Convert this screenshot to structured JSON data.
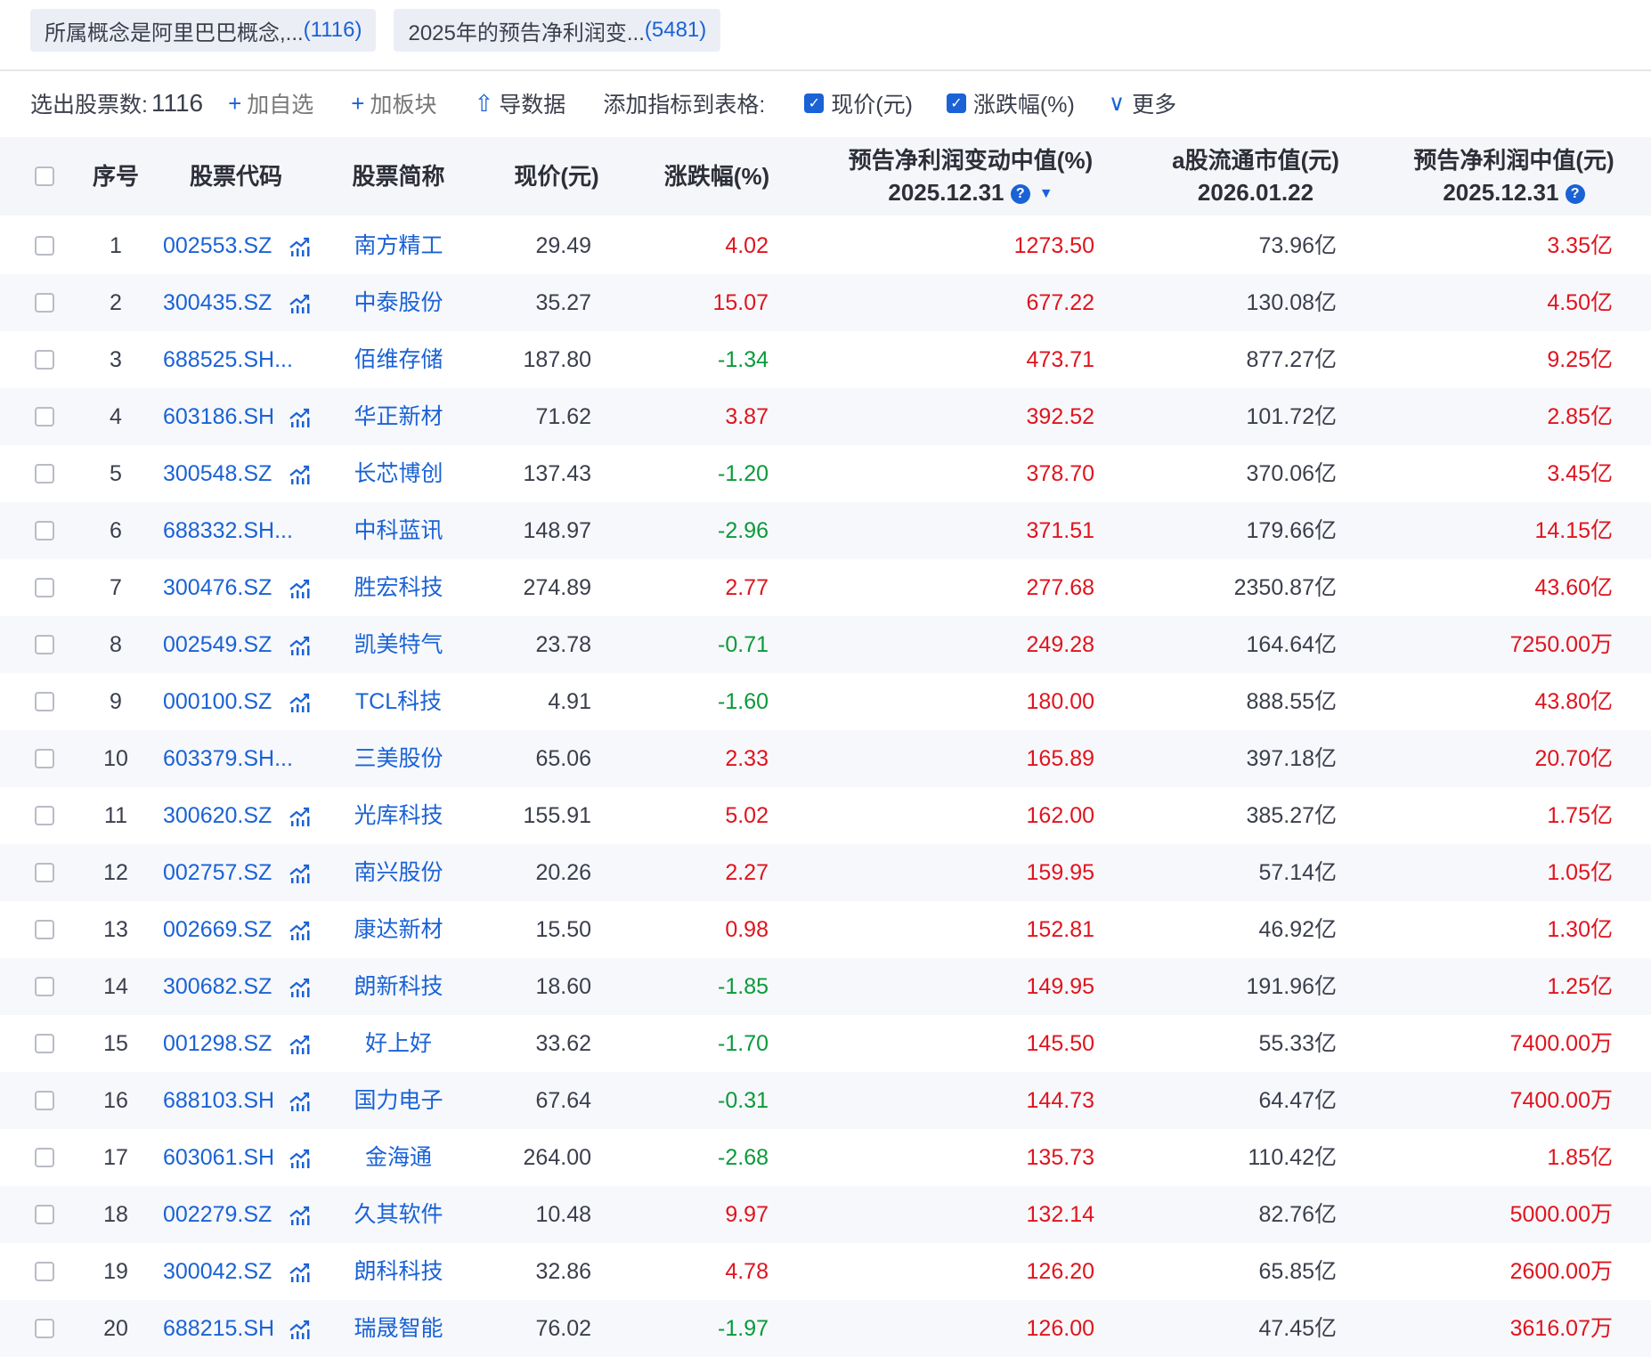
{
  "tabs": [
    {
      "label": "所属概念是阿里巴巴概念,...",
      "count": "(1116)"
    },
    {
      "label": "2025年的预告净利润变...",
      "count": "(5481)"
    }
  ],
  "toolbar": {
    "count_label": "选出股票数:",
    "count": "1116",
    "add_watch": "加自选",
    "add_sector": "加板块",
    "export": "导数据",
    "add_indicator": "添加指标到表格:",
    "cb_price": "现价(元)",
    "cb_change": "涨跌幅(%)",
    "more": "更多"
  },
  "columns": {
    "idx": "序号",
    "code": "股票代码",
    "name": "股票简称",
    "price": "现价(元)",
    "change": "涨跌幅(%)",
    "forecast_chg": "预告净利润变动中值(%)",
    "forecast_chg_date": "2025.12.31",
    "cap": "a股流通市值(元)",
    "cap_date": "2026.01.22",
    "forecast_val": "预告净利润中值(元)",
    "forecast_val_date": "2025.12.31"
  },
  "rows": [
    {
      "idx": "1",
      "code": "002553.SZ",
      "name": "南方精工",
      "price": "29.49",
      "change": "4.02",
      "fc": "1273.50",
      "cap": "73.96亿",
      "val": "3.35亿"
    },
    {
      "idx": "2",
      "code": "300435.SZ",
      "name": "中泰股份",
      "price": "35.27",
      "change": "15.07",
      "fc": "677.22",
      "cap": "130.08亿",
      "val": "4.50亿"
    },
    {
      "idx": "3",
      "code": "688525.SH...",
      "name": "佰维存储",
      "price": "187.80",
      "change": "-1.34",
      "fc": "473.71",
      "cap": "877.27亿",
      "val": "9.25亿"
    },
    {
      "idx": "4",
      "code": "603186.SH",
      "name": "华正新材",
      "price": "71.62",
      "change": "3.87",
      "fc": "392.52",
      "cap": "101.72亿",
      "val": "2.85亿"
    },
    {
      "idx": "5",
      "code": "300548.SZ",
      "name": "长芯博创",
      "price": "137.43",
      "change": "-1.20",
      "fc": "378.70",
      "cap": "370.06亿",
      "val": "3.45亿"
    },
    {
      "idx": "6",
      "code": "688332.SH...",
      "name": "中科蓝讯",
      "price": "148.97",
      "change": "-2.96",
      "fc": "371.51",
      "cap": "179.66亿",
      "val": "14.15亿"
    },
    {
      "idx": "7",
      "code": "300476.SZ",
      "name": "胜宏科技",
      "price": "274.89",
      "change": "2.77",
      "fc": "277.68",
      "cap": "2350.87亿",
      "val": "43.60亿"
    },
    {
      "idx": "8",
      "code": "002549.SZ",
      "name": "凯美特气",
      "price": "23.78",
      "change": "-0.71",
      "fc": "249.28",
      "cap": "164.64亿",
      "val": "7250.00万"
    },
    {
      "idx": "9",
      "code": "000100.SZ",
      "name": "TCL科技",
      "price": "4.91",
      "change": "-1.60",
      "fc": "180.00",
      "cap": "888.55亿",
      "val": "43.80亿"
    },
    {
      "idx": "10",
      "code": "603379.SH...",
      "name": "三美股份",
      "price": "65.06",
      "change": "2.33",
      "fc": "165.89",
      "cap": "397.18亿",
      "val": "20.70亿"
    },
    {
      "idx": "11",
      "code": "300620.SZ",
      "name": "光库科技",
      "price": "155.91",
      "change": "5.02",
      "fc": "162.00",
      "cap": "385.27亿",
      "val": "1.75亿"
    },
    {
      "idx": "12",
      "code": "002757.SZ",
      "name": "南兴股份",
      "price": "20.26",
      "change": "2.27",
      "fc": "159.95",
      "cap": "57.14亿",
      "val": "1.05亿"
    },
    {
      "idx": "13",
      "code": "002669.SZ",
      "name": "康达新材",
      "price": "15.50",
      "change": "0.98",
      "fc": "152.81",
      "cap": "46.92亿",
      "val": "1.30亿"
    },
    {
      "idx": "14",
      "code": "300682.SZ",
      "name": "朗新科技",
      "price": "18.60",
      "change": "-1.85",
      "fc": "149.95",
      "cap": "191.96亿",
      "val": "1.25亿"
    },
    {
      "idx": "15",
      "code": "001298.SZ",
      "name": "好上好",
      "price": "33.62",
      "change": "-1.70",
      "fc": "145.50",
      "cap": "55.33亿",
      "val": "7400.00万"
    },
    {
      "idx": "16",
      "code": "688103.SH",
      "name": "国力电子",
      "price": "67.64",
      "change": "-0.31",
      "fc": "144.73",
      "cap": "64.47亿",
      "val": "7400.00万"
    },
    {
      "idx": "17",
      "code": "603061.SH",
      "name": "金海通",
      "price": "264.00",
      "change": "-2.68",
      "fc": "135.73",
      "cap": "110.42亿",
      "val": "1.85亿"
    },
    {
      "idx": "18",
      "code": "002279.SZ",
      "name": "久其软件",
      "price": "10.48",
      "change": "9.97",
      "fc": "132.14",
      "cap": "82.76亿",
      "val": "5000.00万"
    },
    {
      "idx": "19",
      "code": "300042.SZ",
      "name": "朗科科技",
      "price": "32.86",
      "change": "4.78",
      "fc": "126.20",
      "cap": "65.85亿",
      "val": "2600.00万"
    },
    {
      "idx": "20",
      "code": "688215.SH",
      "name": "瑞晟智能",
      "price": "76.02",
      "change": "-1.97",
      "fc": "126.00",
      "cap": "47.45亿",
      "val": "3616.07万"
    }
  ]
}
